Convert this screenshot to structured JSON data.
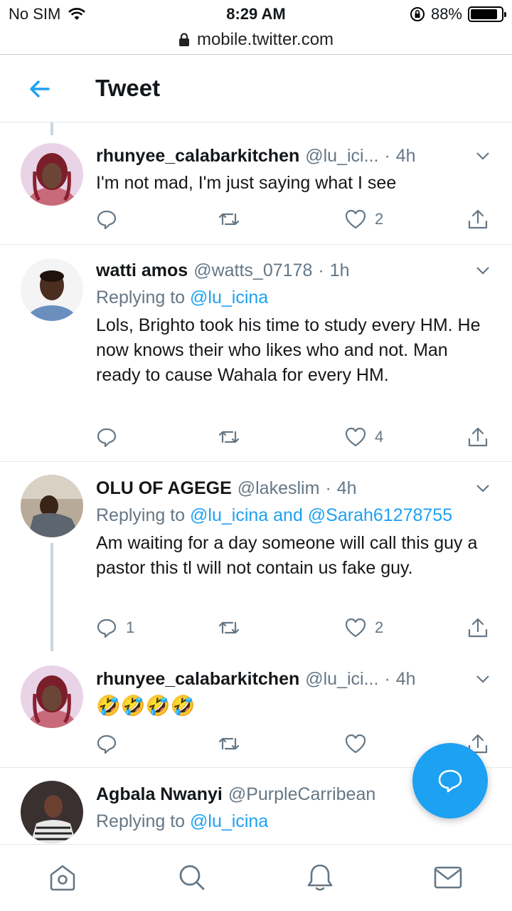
{
  "status_bar": {
    "carrier": "No SIM",
    "time": "8:29 AM",
    "battery": "88%",
    "battery_level": 0.88
  },
  "browser": {
    "url": "mobile.twitter.com"
  },
  "header": {
    "title": "Tweet"
  },
  "tweets": [
    {
      "name": "rhunyee_calabarkitchen",
      "handle": "@lu_ici...",
      "age": "4h",
      "text": "I'm not mad, I'm just saying what I see",
      "replies": "",
      "likes": "2"
    },
    {
      "name": "watti amos",
      "handle": "@watts_07178",
      "age": "1h",
      "reply_prefix": "Replying to",
      "reply_mentions": "@lu_icina",
      "text": "Lols, Brighto took his time to study every HM. He now knows their who likes who and not. Man ready to cause Wahala for every HM.",
      "replies": "",
      "likes": "4"
    },
    {
      "name": "OLU OF AGEGE",
      "handle": "@lakeslim",
      "age": "4h",
      "reply_prefix": "Replying to",
      "reply_mentions": "@lu_icina and @Sarah61278755",
      "text": "Am waiting for a day someone will call this guy a pastor this tl will not contain us fake guy.",
      "replies": "1",
      "likes": "2"
    },
    {
      "name": "rhunyee_calabarkitchen",
      "handle": "@lu_ici...",
      "age": "4h",
      "text": "🤣🤣🤣🤣",
      "replies": "",
      "likes": ""
    },
    {
      "name": "Agbala Nwanyi",
      "handle": "@PurpleCarribean",
      "age": "",
      "reply_prefix": "Replying to",
      "reply_mentions": "@lu_icina"
    }
  ],
  "icons": {
    "back": "arrow-left-icon",
    "reply": "reply-icon",
    "retweet": "retweet-icon",
    "like": "heart-icon",
    "share": "share-icon",
    "fab": "compose-message-icon",
    "nav": [
      "home-icon",
      "search-icon",
      "notifications-icon",
      "messages-icon"
    ]
  },
  "colors": {
    "accent": "#1da1f2",
    "secondary_text": "#657786",
    "divider": "#e1e8ed"
  }
}
